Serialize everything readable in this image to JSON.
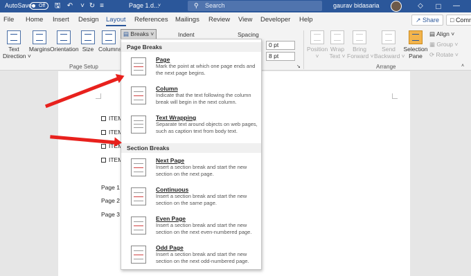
{
  "titlebar": {
    "autosave_label": "AutoSave",
    "autosave_state": "Off",
    "doc_name": "Page 1.d...",
    "search_placeholder": "Search",
    "user_name": "gaurav bidasaria"
  },
  "tabs": [
    "File",
    "Home",
    "Insert",
    "Design",
    "Layout",
    "References",
    "Mailings",
    "Review",
    "View",
    "Developer",
    "Help"
  ],
  "active_tab": "Layout",
  "share_label": "Share",
  "comments_label": "Comm",
  "ribbon": {
    "text_direction": [
      "Text",
      "Direction ˅"
    ],
    "margins": "Margins",
    "orientation": "Orientation",
    "size": "Size",
    "columns": "Columns",
    "breaks_button": "Breaks ˅",
    "page_setup_group": "Page Setup",
    "indent_label": "Indent",
    "spacing_label": "Spacing",
    "spacing_before": "0 pt",
    "spacing_after": "8 pt",
    "position": [
      "Position",
      "˅"
    ],
    "wrap_text": [
      "Wrap",
      "Text ˅"
    ],
    "bring_forward": [
      "Bring",
      "Forward ˅"
    ],
    "send_backward": [
      "Send",
      "Backward ˅"
    ],
    "selection_pane": [
      "Selection",
      "Pane"
    ],
    "align": "Align ˅",
    "group": "Group ˅",
    "rotate": "Rotate ˅",
    "arrange_group": "Arrange"
  },
  "breaks_menu": {
    "page_breaks_header": "Page Breaks",
    "section_breaks_header": "Section Breaks",
    "items": [
      {
        "title": "Page",
        "desc": "Mark the point at which one page ends and the next page begins."
      },
      {
        "title": "Column",
        "desc": "Indicate that the text following the column break will begin in the next column."
      },
      {
        "title": "Text Wrapping",
        "desc": "Separate text around objects on web pages, such as caption text from body text."
      },
      {
        "title": "Next Page",
        "desc": "Insert a section break and start the new section on the next page."
      },
      {
        "title": "Continuous",
        "desc": "Insert a section break and start the new section on the same page."
      },
      {
        "title": "Even Page",
        "desc": "Insert a section break and start the new section on the next even-numbered page."
      },
      {
        "title": "Odd Page",
        "desc": "Insert a section break and start the new section on the next odd-numbered page."
      }
    ]
  },
  "document": {
    "checklist": [
      "ITEM",
      "ITEM",
      "ITEM",
      "ITEM"
    ],
    "pages": [
      "Page 1",
      "Page 2",
      "Page 3"
    ]
  },
  "colors": {
    "titlebar": "#2b579a",
    "arrow": "#e8211d",
    "selection_pane_icon": "#f3b44c"
  }
}
